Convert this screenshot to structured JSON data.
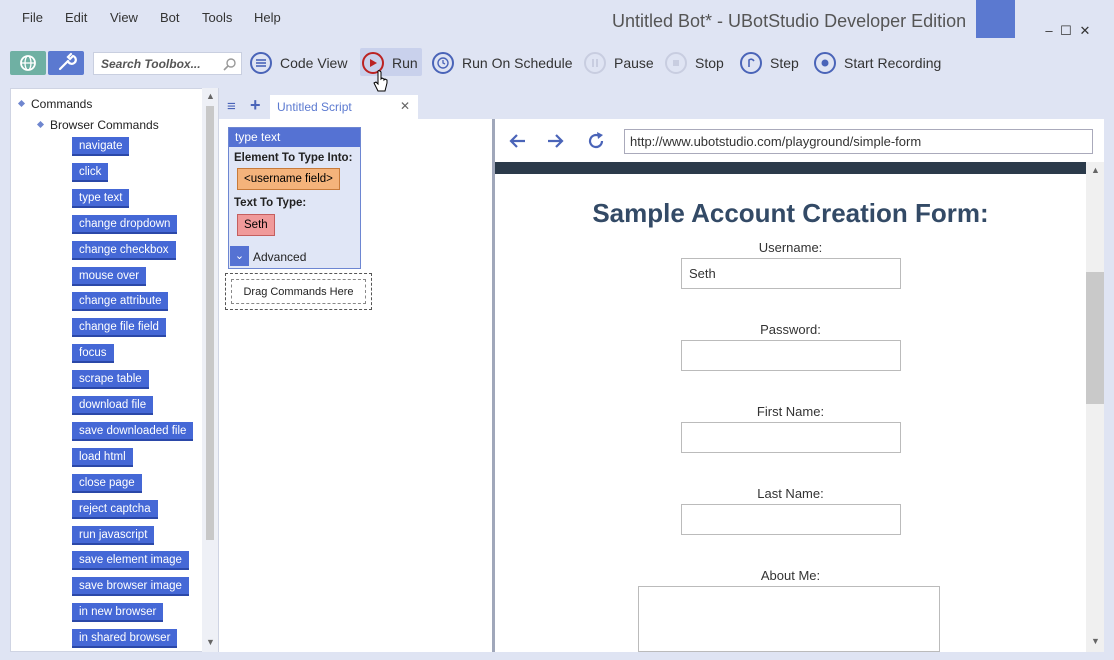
{
  "menu": [
    "File",
    "Edit",
    "View",
    "Bot",
    "Tools",
    "Help"
  ],
  "window": {
    "title": "Untitled Bot* - UBotStudio Developer Edition",
    "minimize": "–",
    "maximize": "☐",
    "close": "✕"
  },
  "toolbar": {
    "search_placeholder": "Search Toolbox...",
    "code_view": "Code View",
    "run": "Run",
    "run_on_schedule": "Run On Schedule",
    "pause": "Pause",
    "stop": "Stop",
    "step": "Step",
    "start_recording": "Start Recording"
  },
  "toolbox": {
    "root": "Commands",
    "group": "Browser Commands",
    "commands": [
      "navigate",
      "click",
      "type text",
      "change dropdown",
      "change checkbox",
      "mouse over",
      "change attribute",
      "change file field",
      "focus",
      "scrape table",
      "download file",
      "save downloaded file",
      "load html",
      "close page",
      "reject captcha",
      "run javascript",
      "save element image",
      "save browser image",
      "in new browser",
      "in shared browser"
    ]
  },
  "tabs": {
    "menu_icon": "≡",
    "add_icon": "+",
    "script_tab": "Untitled Script",
    "close": "✕"
  },
  "script": {
    "block_title": "type text",
    "element_label": "Element To Type Into:",
    "element_value": "<username field>",
    "text_label": "Text To Type:",
    "text_value": "Seth",
    "advanced": "Advanced",
    "dropzone": "Drag Commands Here"
  },
  "browser": {
    "url": "http://www.ubotstudio.com/playground/simple-form",
    "form_title": "Sample Account Creation Form:",
    "fields": {
      "username_label": "Username:",
      "username_value": "Seth",
      "password_label": "Password:",
      "firstname_label": "First Name:",
      "lastname_label": "Last Name:",
      "about_label": "About Me:"
    }
  },
  "colors": {
    "accent": "#4568d6",
    "background": "#dfe4f3",
    "title_accent": "#5b79d0"
  }
}
